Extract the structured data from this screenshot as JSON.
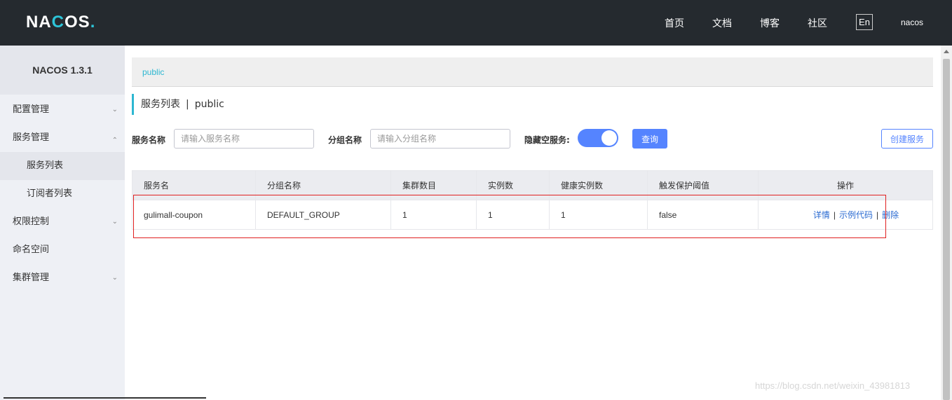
{
  "header": {
    "logo": "NACOS.",
    "nav": [
      "首页",
      "文档",
      "博客",
      "社区"
    ],
    "lang": "En",
    "user": "nacos"
  },
  "sidebar": {
    "title": "NACOS 1.3.1",
    "items": [
      {
        "label": "配置管理",
        "expanded": false
      },
      {
        "label": "服务管理",
        "expanded": true
      },
      {
        "label": "服务列表",
        "active": true
      },
      {
        "label": "订阅者列表"
      },
      {
        "label": "权限控制",
        "expanded": false
      },
      {
        "label": "命名空间"
      },
      {
        "label": "集群管理",
        "expanded": false
      }
    ]
  },
  "main": {
    "breadcrumb": "public",
    "page_title": "服务列表",
    "page_title_sep": "|",
    "namespace": "public",
    "filters": {
      "service_name_label": "服务名称",
      "service_name_placeholder": "请输入服务名称",
      "group_name_label": "分组名称",
      "group_name_placeholder": "请输入分组名称",
      "hide_empty_label": "隐藏空服务:",
      "hide_empty_on": true,
      "query_button": "查询",
      "create_button": "创建服务"
    },
    "table": {
      "headers": [
        "服务名",
        "分组名称",
        "集群数目",
        "实例数",
        "健康实例数",
        "触发保护阈值",
        "操作"
      ],
      "rows": [
        {
          "name": "gulimall-coupon",
          "group": "DEFAULT_GROUP",
          "clusters": "1",
          "instances": "1",
          "healthy": "1",
          "threshold": "false"
        }
      ],
      "actions": [
        "详情",
        "示例代码",
        "删除"
      ],
      "action_sep": "|"
    }
  },
  "watermark": "https://blog.csdn.net/weixin_43981813",
  "colors": {
    "header_bg": "#252a2f",
    "accent": "#5584ff",
    "link": "#2a6ad1",
    "breadcrumb": "#2db7d1",
    "highlight_box": "#e02020"
  }
}
